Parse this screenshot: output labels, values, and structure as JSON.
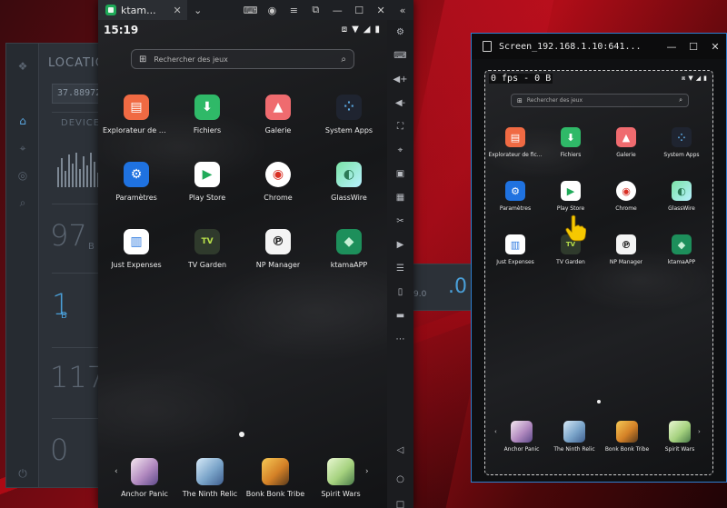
{
  "background_app": {
    "title": "LOCATIO",
    "coordinate": "37.88972",
    "devices_label": "DEVICE",
    "stats": [
      {
        "value": "97",
        "unit": "B"
      },
      {
        "value": "1",
        "unit": "B"
      },
      {
        "value": "117",
        "unit": ""
      },
      {
        "value": "0",
        "unit": ""
      }
    ],
    "side_values": {
      "small": "9.0",
      "large": ".0"
    }
  },
  "emulator": {
    "tab_title": "ktam...",
    "tab_close": "✕",
    "status_time": "15:19",
    "search_placeholder": "Rechercher des jeux",
    "apps": [
      {
        "label": "Explorateur de fic...",
        "glyph": "▤"
      },
      {
        "label": "Fichiers",
        "glyph": "⬇"
      },
      {
        "label": "Galerie",
        "glyph": "▲"
      },
      {
        "label": "System Apps",
        "glyph": "⁘"
      },
      {
        "label": "Paramètres",
        "glyph": "⚙"
      },
      {
        "label": "Play Store",
        "glyph": "▶"
      },
      {
        "label": "Chrome",
        "glyph": "◉"
      },
      {
        "label": "GlassWire",
        "glyph": "◐"
      },
      {
        "label": "Just Expenses",
        "glyph": "▥"
      },
      {
        "label": "TV Garden",
        "glyph": "TV"
      },
      {
        "label": "NP Manager",
        "glyph": "℗"
      },
      {
        "label": "ktamaAPP",
        "glyph": "◆"
      }
    ],
    "dock": [
      {
        "label": "Anchor Panic"
      },
      {
        "label": "The Ninth Relic"
      },
      {
        "label": "Bonk Bonk Tribe"
      },
      {
        "label": "Spirit Wars"
      }
    ]
  },
  "cast_window": {
    "title": "Screen_192.168.1.10:641...",
    "fps": "0 fps - 0 B"
  },
  "colors": {
    "accent_blue": "#4a9fd8",
    "desktop_red": "#b00d18",
    "cast_border": "#2e7fd0"
  }
}
